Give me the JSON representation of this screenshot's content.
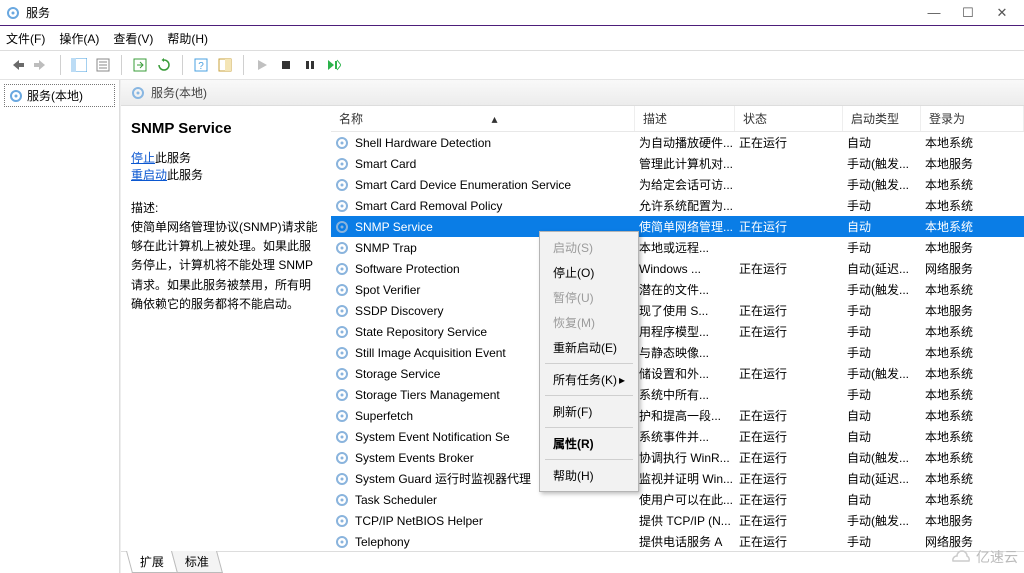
{
  "window": {
    "title": "服务"
  },
  "menu": [
    "文件(F)",
    "操作(A)",
    "查看(V)",
    "帮助(H)"
  ],
  "tree": {
    "root": "服务(本地)"
  },
  "details_header": "服务(本地)",
  "info": {
    "name": "SNMP Service",
    "stop_prefix": "停止",
    "stop_suffix": "此服务",
    "restart_prefix": "重启动",
    "restart_suffix": "此服务",
    "desc_label": "描述:",
    "desc_text": "使简单网络管理协议(SNMP)请求能够在此计算机上被处理。如果此服务停止，计算机将不能处理 SNMP 请求。如果此服务被禁用，所有明确依赖它的服务都将不能启动。"
  },
  "columns": {
    "name": "名称",
    "desc": "描述",
    "status": "状态",
    "start": "启动类型",
    "logon": "登录为"
  },
  "rows": [
    {
      "n": "Shell Hardware Detection",
      "d": "为自动播放硬件...",
      "s": "正在运行",
      "t": "自动",
      "l": "本地系统"
    },
    {
      "n": "Smart Card",
      "d": "管理此计算机对...",
      "s": "",
      "t": "手动(触发...",
      "l": "本地服务"
    },
    {
      "n": "Smart Card Device Enumeration Service",
      "d": "为给定会话可访...",
      "s": "",
      "t": "手动(触发...",
      "l": "本地系统"
    },
    {
      "n": "Smart Card Removal Policy",
      "d": "允许系统配置为...",
      "s": "",
      "t": "手动",
      "l": "本地系统"
    },
    {
      "n": "SNMP Service",
      "d": "使简单网络管理...",
      "s": "正在运行",
      "t": "自动",
      "l": "本地系统",
      "sel": true
    },
    {
      "n": "SNMP Trap",
      "d": "本地或远程...",
      "s": "",
      "t": "手动",
      "l": "本地服务"
    },
    {
      "n": "Software Protection",
      "d": "Windows ...",
      "s": "正在运行",
      "t": "自动(延迟...",
      "l": "网络服务"
    },
    {
      "n": "Spot Verifier",
      "d": "潜在的文件...",
      "s": "",
      "t": "手动(触发...",
      "l": "本地系统"
    },
    {
      "n": "SSDP Discovery",
      "d": "现了使用 S...",
      "s": "正在运行",
      "t": "手动",
      "l": "本地服务"
    },
    {
      "n": "State Repository Service",
      "d": "用程序模型...",
      "s": "正在运行",
      "t": "手动",
      "l": "本地系统"
    },
    {
      "n": "Still Image Acquisition Event",
      "d": "与静态映像...",
      "s": "",
      "t": "手动",
      "l": "本地系统"
    },
    {
      "n": "Storage Service",
      "d": "储设置和外...",
      "s": "正在运行",
      "t": "手动(触发...",
      "l": "本地系统"
    },
    {
      "n": "Storage Tiers Management",
      "d": "系统中所有...",
      "s": "",
      "t": "手动",
      "l": "本地系统"
    },
    {
      "n": "Superfetch",
      "d": "护和提高一段...",
      "s": "正在运行",
      "t": "自动",
      "l": "本地系统"
    },
    {
      "n": "System Event Notification Se",
      "d": "系统事件并...",
      "s": "正在运行",
      "t": "自动",
      "l": "本地系统"
    },
    {
      "n": "System Events Broker",
      "d": "协调执行 WinR...",
      "s": "正在运行",
      "t": "自动(触发...",
      "l": "本地系统"
    },
    {
      "n": "System Guard 运行时监视器代理",
      "d": "监视并证明 Win...",
      "s": "正在运行",
      "t": "自动(延迟...",
      "l": "本地系统"
    },
    {
      "n": "Task Scheduler",
      "d": "使用户可以在此...",
      "s": "正在运行",
      "t": "自动",
      "l": "本地系统"
    },
    {
      "n": "TCP/IP NetBIOS Helper",
      "d": "提供 TCP/IP (N...",
      "s": "正在运行",
      "t": "手动(触发...",
      "l": "本地服务"
    },
    {
      "n": "Telephony",
      "d": "提供电话服务 A",
      "s": "正在运行",
      "t": "手动",
      "l": "网络服务"
    }
  ],
  "context": [
    {
      "label": "启动(S)",
      "disabled": true
    },
    {
      "label": "停止(O)"
    },
    {
      "label": "暂停(U)",
      "disabled": true
    },
    {
      "label": "恢复(M)",
      "disabled": true
    },
    {
      "label": "重新启动(E)"
    },
    {
      "sep": true
    },
    {
      "label": "所有任务(K)",
      "sub": true
    },
    {
      "sep": true
    },
    {
      "label": "刷新(F)"
    },
    {
      "sep": true
    },
    {
      "label": "属性(R)",
      "bold": true
    },
    {
      "sep": true
    },
    {
      "label": "帮助(H)"
    }
  ],
  "tabs": {
    "extended": "扩展",
    "standard": "标准"
  },
  "watermark": "亿速云"
}
